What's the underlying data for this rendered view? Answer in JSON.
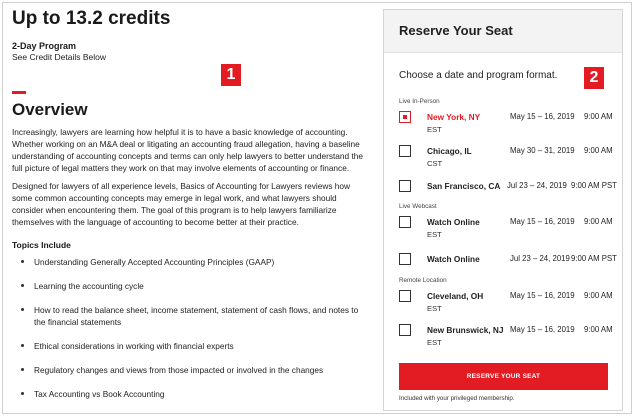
{
  "header": {
    "credits": "Up to 13.2 credits",
    "program_type": "2-Day Program",
    "credit_details": "See Credit Details Below"
  },
  "overview": {
    "title": "Overview",
    "para1": "Increasingly, lawyers are learning how helpful it is to have a basic knowledge of accounting. Whether working on an M&A deal or litigating an accounting fraud allegation, having a baseline understanding of accounting concepts and terms can only help lawyers to better understand the full picture of legal matters they work on that may involve elements of accounting or finance.",
    "para2": "Designed for lawyers of all experience levels, Basics of Accounting for Lawyers reviews how some common accounting concepts may emerge in legal work, and what lawyers should consider when encountering them. The goal of this program is to help lawyers familiarize themselves with the language of accounting to become better at their practice.",
    "topics_title": "Topics Include",
    "topics": [
      "Understanding Generally Accepted Accounting Principles (GAAP)",
      "Learning the accounting cycle",
      "How to read the balance sheet, income statement, statement of cash flows, and notes to the financial statements",
      "Ethical considerations in working with financial experts",
      "Regulatory changes and views from those impacted or involved in the changes",
      "Tax Accounting vs Book Accounting"
    ]
  },
  "badges": {
    "one": "1",
    "two": "2"
  },
  "panel": {
    "title": "Reserve Your Seat",
    "choose": "Choose a date and program format.",
    "groups": {
      "in_person": "Live In-Person",
      "webcast": "Live Webcast",
      "remote": "Remote Location"
    },
    "sessions": [
      {
        "location": "New York, NY",
        "tz": "EST",
        "dates": "May 15 – 16, 2019",
        "time": "9:00 AM",
        "checked": true
      },
      {
        "location": "Chicago, IL",
        "tz": "CST",
        "dates": "May 30 – 31, 2019",
        "time": "9:00 AM",
        "checked": false
      },
      {
        "location": "San Francisco, CA",
        "tz": "",
        "dates": "Jul 23 – 24, 2019",
        "time": "9:00 AM PST",
        "checked": false
      },
      {
        "location": "Watch Online",
        "tz": "EST",
        "dates": "May 15 – 16, 2019",
        "time": "9:00 AM",
        "checked": false
      },
      {
        "location": "Watch Online",
        "tz": "",
        "dates": "Jul 23 – 24, 2019",
        "time": "9:00 AM PST",
        "checked": false
      },
      {
        "location": "Cleveland, OH",
        "tz": "EST",
        "dates": "May 15 – 16, 2019",
        "time": "9:00 AM",
        "checked": false
      },
      {
        "location": "New Brunswick, NJ",
        "tz": "EST",
        "dates": "May 15 – 16, 2019",
        "time": "9:00 AM",
        "checked": false
      }
    ],
    "reserve_label": "RESERVE YOUR SEAT",
    "included": "Included with your privileged membership."
  },
  "colors": {
    "accent": "#e31b23"
  }
}
